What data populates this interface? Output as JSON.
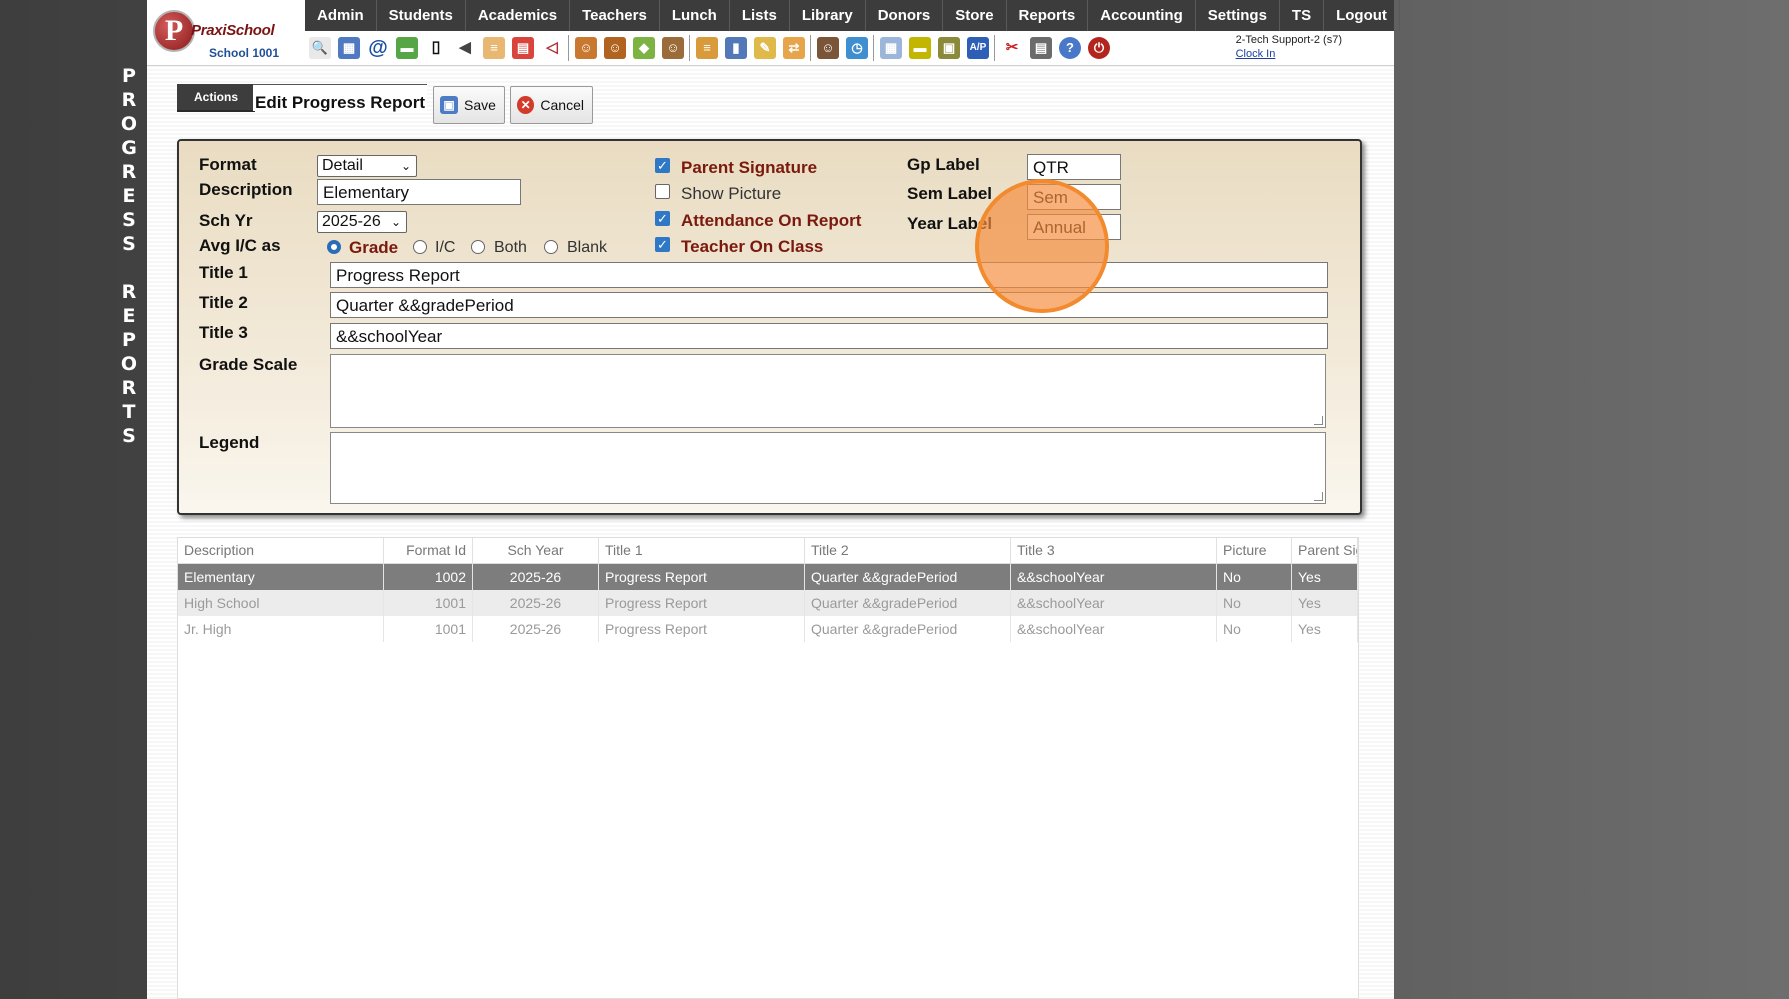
{
  "side_title": {
    "letters": [
      "P",
      "R",
      "O",
      "G",
      "R",
      "E",
      "S",
      "S",
      "",
      "R",
      "E",
      "P",
      "O",
      "R",
      "T",
      "S"
    ]
  },
  "logo": {
    "initial": "P",
    "brand": "PraxiSchool",
    "school": "School 1001"
  },
  "menu": [
    "Admin",
    "Students",
    "Academics",
    "Teachers",
    "Lunch",
    "Lists",
    "Library",
    "Donors",
    "Store",
    "Reports",
    "Accounting",
    "Settings",
    "TS",
    "Logout"
  ],
  "toolbar_icons": [
    "search-icon",
    "calendar-grid-icon",
    "email-at-icon",
    "chat-icon",
    "phone-icon",
    "sound-icon",
    "report-card-icon",
    "calendar-icon",
    "announce-icon",
    "student-icon",
    "teacher-icon",
    "tag-icon",
    "family-icon",
    "burger-icon",
    "book-icon",
    "pencil-icon",
    "transfer-icon",
    "staff-icon",
    "clock-icon",
    "sheet-icon",
    "card-icon",
    "register-icon",
    "ap-icon",
    "pdf-icon",
    "printer-icon",
    "help-icon",
    "power-icon"
  ],
  "user": {
    "name": "2-Tech Support-2 (s7)",
    "clock_in": "Clock In"
  },
  "actions_label": "Actions",
  "form_title": "Edit Progress Report",
  "buttons": {
    "save": "Save",
    "cancel": "Cancel"
  },
  "form": {
    "format_label": "Format",
    "format_value": "Detail",
    "description_label": "Description",
    "description_value": "Elementary",
    "schyr_label": "Sch Yr",
    "schyr_value": "2025-26",
    "avg_label": "Avg I/C as",
    "avg_options": [
      "Grade",
      "I/C",
      "Both",
      "Blank"
    ],
    "avg_selected": "Grade",
    "title1_label": "Title 1",
    "title1_value": "Progress Report",
    "title2_label": "Title 2",
    "title2_value": "Quarter &&gradePeriod",
    "title3_label": "Title 3",
    "title3_value": "&&schoolYear",
    "grade_scale_label": "Grade Scale",
    "grade_scale_value": "",
    "legend_label": "Legend",
    "legend_value": "",
    "checkboxes": [
      {
        "label": "Parent Signature",
        "checked": true
      },
      {
        "label": "Show Picture",
        "checked": false
      },
      {
        "label": "Attendance On Report",
        "checked": true
      },
      {
        "label": "Teacher On Class",
        "checked": true
      }
    ],
    "gp_label": "Gp Label",
    "gp_value": "QTR",
    "sem_label": "Sem Label",
    "sem_value": "Sem",
    "year_label": "Year Label",
    "year_value": "Annual"
  },
  "table": {
    "columns": [
      "Description",
      "Format Id",
      "Sch Year",
      "Title 1",
      "Title 2",
      "Title 3",
      "Picture",
      "Parent Sig"
    ],
    "rows": [
      [
        "Elementary",
        "1002",
        "2025-26",
        "Progress Report",
        "Quarter &&gradePeriod",
        "&&schoolYear",
        "No",
        "Yes"
      ],
      [
        "High School",
        "1001",
        "2025-26",
        "Progress Report",
        "Quarter &&gradePeriod",
        "&&schoolYear",
        "No",
        "Yes"
      ],
      [
        "Jr. High",
        "1001",
        "2025-26",
        "Progress Report",
        "Quarter &&gradePeriod",
        "&&schoolYear",
        "No",
        "Yes"
      ]
    ],
    "selected_row": 0
  }
}
